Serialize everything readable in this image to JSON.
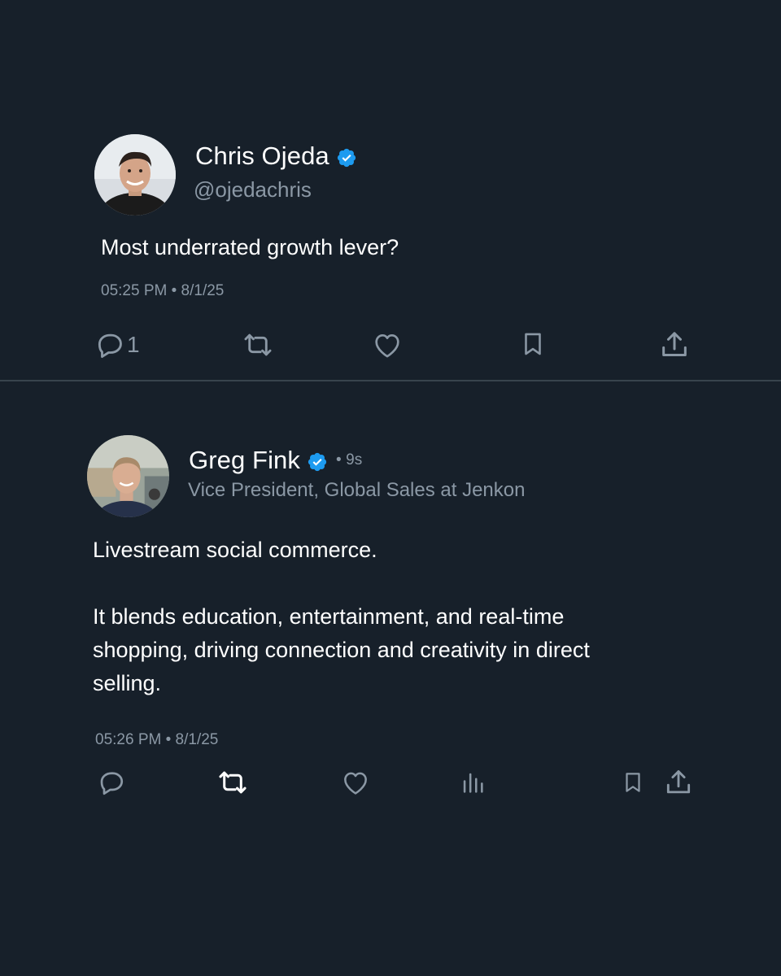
{
  "colors": {
    "background": "#17202a",
    "text_primary": "#ffffff",
    "text_secondary": "#8b98a5",
    "verified": "#1d9bf0",
    "divider": "#38444d"
  },
  "tweet1": {
    "author_name": "Chris Ojeda",
    "handle": "@ojedachris",
    "verified": true,
    "text": "Most underrated growth lever?",
    "timestamp": "05:25 PM • 8/1/25",
    "reply_count": "1",
    "actions": [
      "reply-icon",
      "retweet-icon",
      "like-icon",
      "bookmark-icon",
      "share-icon"
    ]
  },
  "tweet2": {
    "author_name": "Greg Fink",
    "verified": true,
    "age": "• 9s",
    "subtitle": "Vice President, Global Sales at Jenkon",
    "paragraph1": "Livestream social commerce.",
    "paragraph2_line1": "It blends education, entertainment, and real-time",
    "paragraph2_line2": "shopping, driving connection and creativity in direct",
    "paragraph2_line3": "selling.",
    "timestamp": "05:26 PM • 8/1/25",
    "actions": [
      "reply-icon",
      "retweet-icon",
      "like-icon",
      "views-icon",
      "bookmark-icon",
      "share-icon"
    ]
  }
}
